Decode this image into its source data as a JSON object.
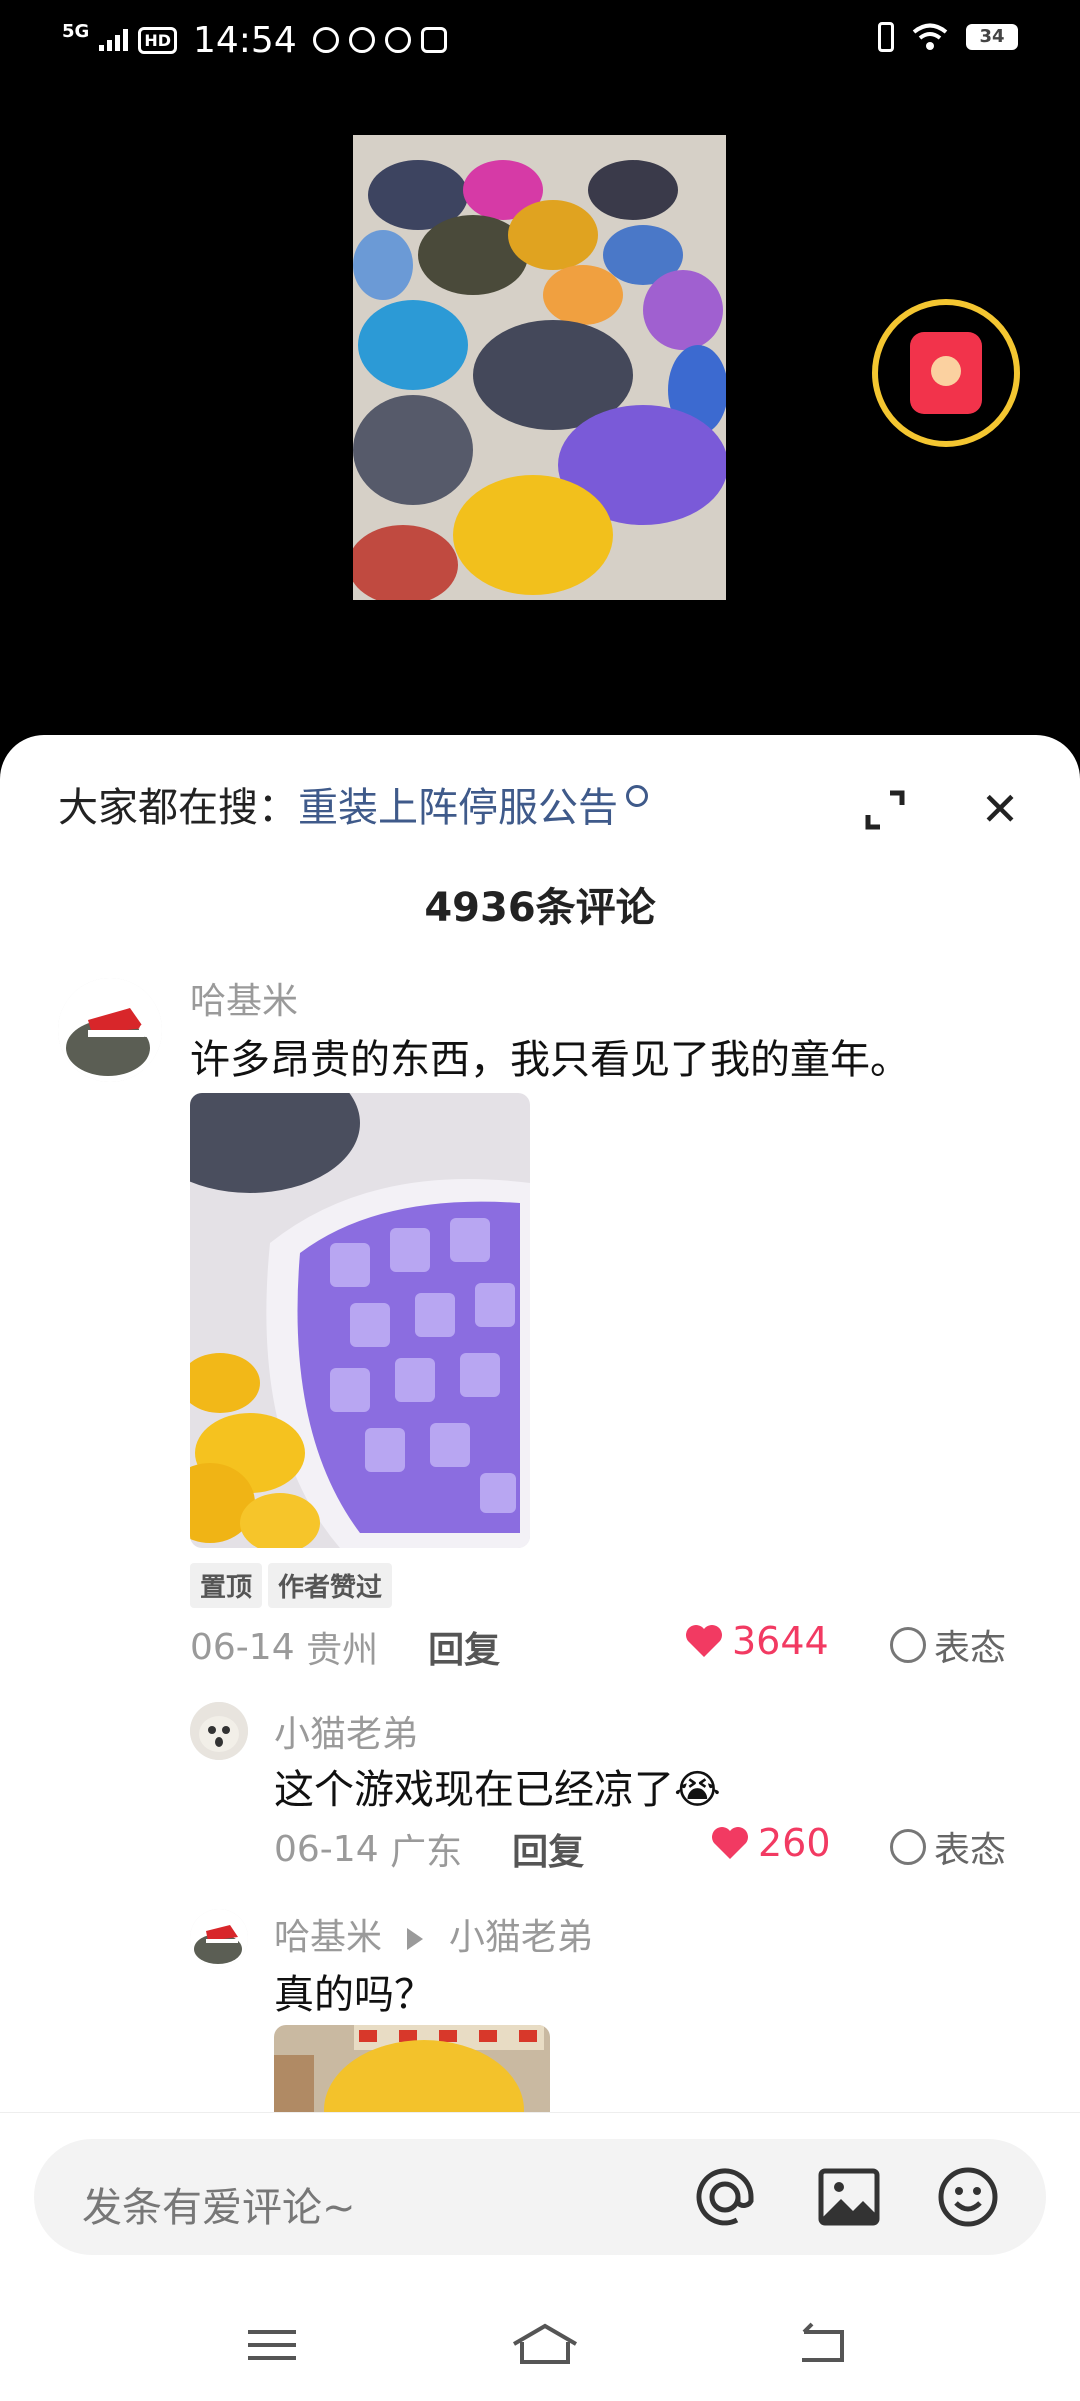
{
  "status_bar": {
    "network": "5G",
    "hd": "HD",
    "time": "14:54",
    "battery": "34"
  },
  "search": {
    "prefix": "大家都在搜：",
    "hot_query": "重装上阵停服公告"
  },
  "comments_count_title": "4936条评论",
  "comments": [
    {
      "user": "哈基米",
      "text": "许多昂贵的东西，我只看见了我的童年。",
      "tags": [
        "置顶",
        "作者赞过"
      ],
      "date": "06-14",
      "location": "贵州",
      "reply_label": "回复",
      "likes": "3644",
      "react_label": "表态"
    }
  ],
  "replies": [
    {
      "user": "小猫老弟",
      "text": "这个游戏现在已经凉了😭",
      "date": "06-14",
      "location": "广东",
      "reply_label": "回复",
      "likes": "260",
      "react_label": "表态"
    },
    {
      "user": "哈基米",
      "reply_to": "小猫老弟",
      "text": "真的吗？"
    }
  ],
  "input": {
    "placeholder": "发条有爱评论~"
  },
  "icons": {
    "expand": "expand-icon",
    "close": "close-icon",
    "at": "at-icon",
    "image": "image-icon",
    "emoji": "emoji-icon",
    "menu": "menu-icon",
    "home": "home-icon",
    "back": "back-icon"
  },
  "colors": {
    "like": "#f23a62",
    "hot_search": "#3f5a8a",
    "redpacket_ring": "#f4c631"
  }
}
